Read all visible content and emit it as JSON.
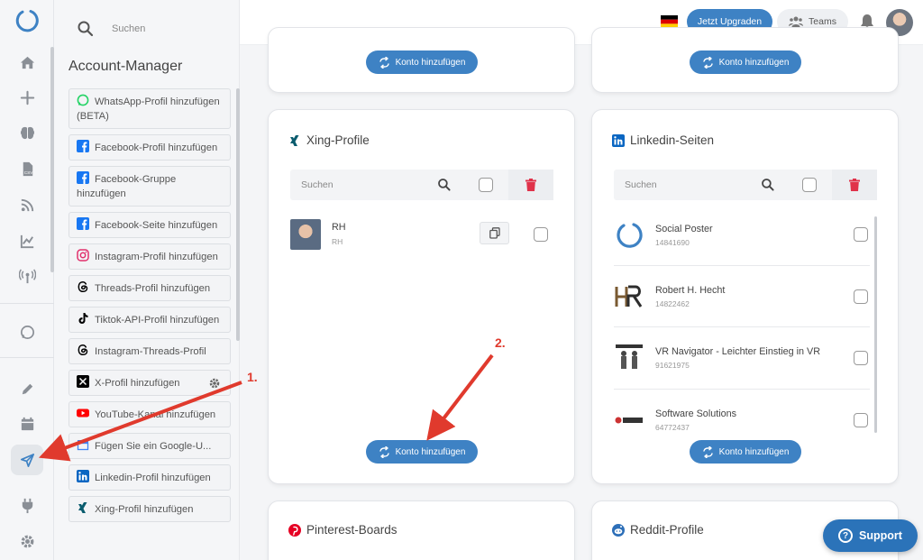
{
  "sidebar_search": {
    "placeholder": "Suchen"
  },
  "account_manager": {
    "title": "Account-Manager",
    "items": [
      {
        "label": "WhatsApp-Profil hinzufügen (BETA)",
        "icon": "whatsapp-icon",
        "color": "#25d366"
      },
      {
        "label": "Facebook-Profil hinzufügen",
        "icon": "facebook-icon",
        "color": "#1877f2"
      },
      {
        "label": "Facebook-Gruppe hinzufügen",
        "icon": "facebook-icon",
        "color": "#1877f2"
      },
      {
        "label": "Facebook-Seite hinzufügen",
        "icon": "facebook-icon",
        "color": "#1877f2"
      },
      {
        "label": "Instagram-Profil hinzufügen",
        "icon": "instagram-icon",
        "color": "#e1306c"
      },
      {
        "label": "Threads-Profil hinzufügen",
        "icon": "threads-icon",
        "color": "#000000"
      },
      {
        "label": "Tiktok-API-Profil hinzufügen",
        "icon": "tiktok-icon",
        "color": "#000000"
      },
      {
        "label": "Instagram-Threads-Profil",
        "icon": "threads-icon",
        "color": "#000000"
      },
      {
        "label": "X-Profil hinzufügen",
        "icon": "x-icon",
        "color": "#000000"
      },
      {
        "label": "YouTube-Kanal hinzufügen",
        "icon": "youtube-icon",
        "color": "#ff0000"
      },
      {
        "label": "Fügen Sie ein Google-U...",
        "icon": "google-business-icon",
        "color": "#4285f4"
      },
      {
        "label": "Linkedin-Profil hinzufügen",
        "icon": "linkedin-icon",
        "color": "#0a66c2"
      },
      {
        "label": "Xing-Profil hinzufügen",
        "icon": "xing-icon",
        "color": "#0a5c6e"
      }
    ]
  },
  "topbar": {
    "upgrade_label": "Jetzt Upgraden",
    "teams_label": "Teams"
  },
  "add_account_label": "Konto hinzufügen",
  "search_placeholder": "Suchen",
  "xing_card": {
    "title": "Xing-Profile",
    "profiles": [
      {
        "name": "RH",
        "sub": "RH"
      }
    ]
  },
  "linkedin_card": {
    "title": "Linkedin-Seiten",
    "pages": [
      {
        "name": "Social Poster",
        "id": "14841690"
      },
      {
        "name": "Robert H. Hecht",
        "id": "14822462"
      },
      {
        "name": "VR Navigator - Leichter Einstieg in VR",
        "id": "91621975"
      },
      {
        "name": "Software Solutions",
        "id": "64772437"
      }
    ]
  },
  "pinterest_card": {
    "title": "Pinterest-Boards"
  },
  "reddit_card": {
    "title": "Reddit-Profile"
  },
  "annotations": {
    "step1": "1.",
    "step2": "2."
  },
  "support_label": "Support",
  "colors": {
    "accent": "#3e82c4",
    "danger": "#e0324a",
    "annotation": "#e03a2d"
  }
}
